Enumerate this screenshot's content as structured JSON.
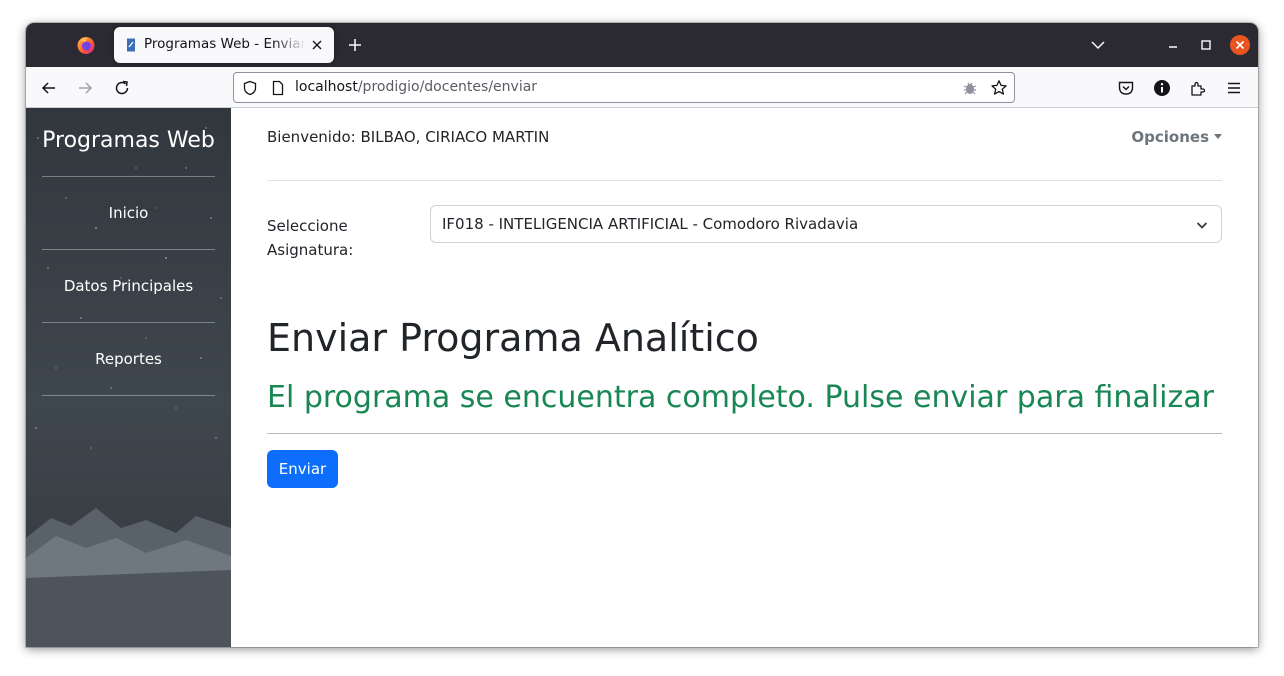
{
  "browser": {
    "tab": {
      "title": "Programas Web - Enviar Programa Analítico",
      "favicon": "page-favicon-icon"
    },
    "url": {
      "host": "localhost",
      "path": "/prodigio/docentes/enviar"
    },
    "icons": {
      "logo": "firefox-logo-icon",
      "new_tab": "plus-icon",
      "list_tabs": "chevron-down-icon",
      "back": "back-arrow-icon",
      "forward": "forward-arrow-icon",
      "reload": "reload-icon",
      "shield": "shield-icon",
      "page_info": "page-icon",
      "bug": "bug-icon",
      "bookmark": "star-icon",
      "pocket": "pocket-icon",
      "account": "info-icon",
      "extensions": "puzzle-icon",
      "menu": "hamburger-menu-icon"
    },
    "colors": {
      "tabbar": "#2b2a33",
      "window_close": "#e95420"
    }
  },
  "sidebar": {
    "brand": "Programas Web",
    "items": [
      {
        "label": "Inicio"
      },
      {
        "label": "Datos Principales"
      },
      {
        "label": "Reportes"
      }
    ]
  },
  "header": {
    "welcome": "Bienvenido: BILBAO, CIRIACO MARTIN",
    "options_label": "Opciones"
  },
  "form": {
    "select_label": "Seleccione Asignatura:",
    "select_value": "IF018 - INTELIGENCIA ARTIFICIAL - Comodoro Rivadavia"
  },
  "main": {
    "title": "Enviar Programa Analítico",
    "status": "El programa se encuentra completo. Pulse enviar para finalizar",
    "send_button": "Enviar"
  },
  "colors": {
    "primary": "#0d6efd",
    "success": "#198754",
    "text": "#212529",
    "muted": "#6c757d"
  }
}
